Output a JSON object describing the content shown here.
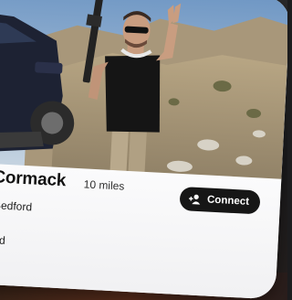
{
  "profile": {
    "name": "cCormack",
    "distance": "10 miles",
    "subtitle": "al Bedford",
    "detail": "dford",
    "photo_description_icon": "profile-photo"
  },
  "actions": {
    "connect_label": "Connect",
    "connect_icon": "add-person-icon"
  },
  "colors": {
    "card_background": "#f0f0f2",
    "button_background": "#161616",
    "button_text": "#ffffff",
    "sky": "#8fb3d6",
    "ground": "#b7a88a"
  }
}
